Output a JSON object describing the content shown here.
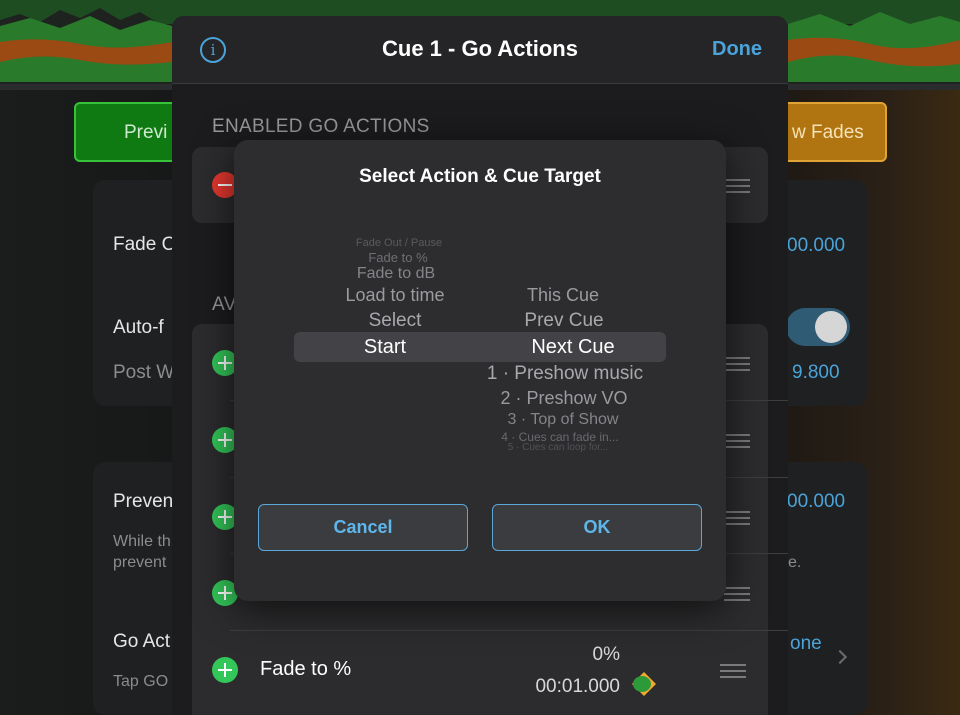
{
  "background": {
    "preview_button": "Previ",
    "fades_button": "w Fades",
    "rows": {
      "fade_label": "Fade O",
      "fade_value": "00.000",
      "autofollow_label": "Auto-f",
      "post_wait_label": "Post W",
      "post_wait_value": "9.800",
      "prevent_label": "Preven",
      "prevent_value": "00.000",
      "prevent_desc_line1": "While th",
      "prevent_desc_line2": "prevent",
      "prevent_desc_end": "e.",
      "go_actions_label": "Go Act",
      "go_actions_value": "one",
      "go_actions_desc": "Tap GO"
    }
  },
  "sheet": {
    "title": "Cue 1 - Go Actions",
    "done_label": "Done",
    "info_glyph": "i",
    "enabled_section": "ENABLED GO ACTIONS",
    "available_section": "AV",
    "last_row": {
      "label": "Fade to %",
      "value_top": "0%",
      "value_bottom": "00:01.000"
    }
  },
  "dialog": {
    "title": "Select Action & Cue Target",
    "action_column": [
      "Fade Out / Pause",
      "Fade to %",
      "Fade to dB",
      "Load to time",
      "Select",
      "Start"
    ],
    "target_column": [
      "This Cue",
      "Prev Cue",
      "Next Cue",
      "1 · Preshow music",
      "2 · Preshow VO",
      "3 · Top of Show",
      "4 · Cues can fade in...",
      "5 · Cues can loop for..."
    ],
    "selected_action": "Start",
    "selected_target": "Next Cue",
    "cancel_label": "Cancel",
    "ok_label": "OK"
  },
  "colors": {
    "accent_blue": "#4aa3d9",
    "add_green": "#33c759",
    "remove_red": "#e7382f",
    "preview_green": "#0f7a12",
    "fades_orange": "#b07410"
  },
  "icons": {
    "info": "info-circle-icon",
    "add": "plus-circle-icon",
    "remove": "minus-circle-icon",
    "reorder": "reorder-grip-icon",
    "fade": "fade-diamond-icon",
    "chevron": "chevron-right-icon"
  }
}
